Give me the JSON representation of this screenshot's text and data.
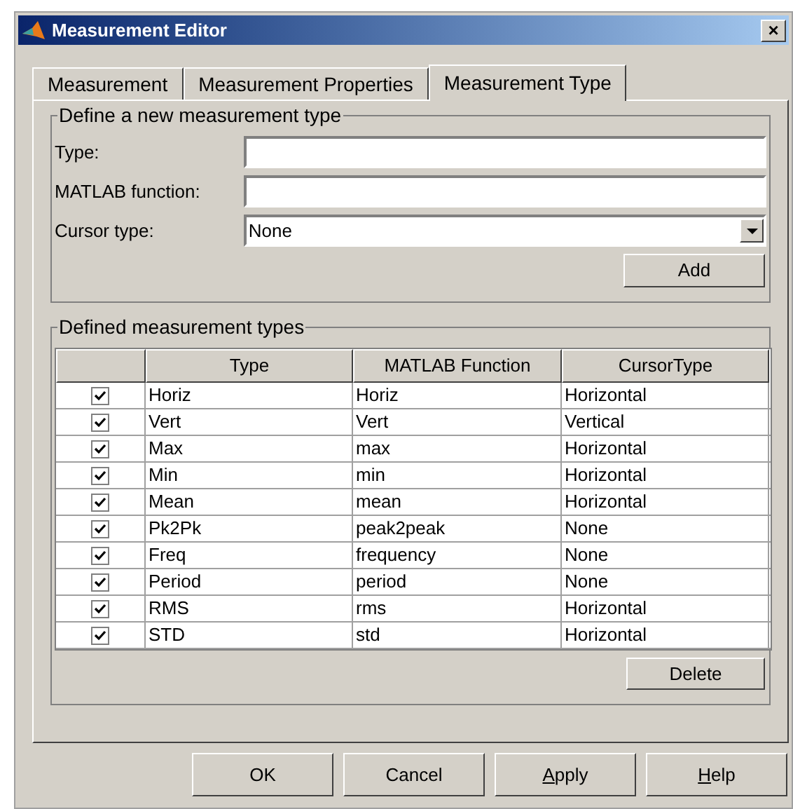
{
  "window": {
    "title": "Measurement Editor",
    "close": "×"
  },
  "tabs": [
    {
      "label": "Measurement",
      "selected": false
    },
    {
      "label": "Measurement Properties",
      "selected": false
    },
    {
      "label": "Measurement Type",
      "selected": true
    }
  ],
  "define_group": {
    "title": "Define a new measurement type",
    "type_label": "Type:",
    "function_label": "MATLAB function:",
    "cursor_label": "Cursor type:",
    "cursor_value": "None",
    "add_button": "Add"
  },
  "types_group": {
    "title": "Defined measurement types",
    "columns": [
      "",
      "Type",
      "MATLAB Function",
      "CursorType"
    ],
    "rows": [
      {
        "checked": true,
        "type": "Horiz",
        "function": "Horiz",
        "cursor": "Horizontal"
      },
      {
        "checked": true,
        "type": "Vert",
        "function": "Vert",
        "cursor": "Vertical"
      },
      {
        "checked": true,
        "type": "Max",
        "function": "max",
        "cursor": "Horizontal"
      },
      {
        "checked": true,
        "type": "Min",
        "function": "min",
        "cursor": "Horizontal"
      },
      {
        "checked": true,
        "type": "Mean",
        "function": "mean",
        "cursor": "Horizontal"
      },
      {
        "checked": true,
        "type": "Pk2Pk",
        "function": "peak2peak",
        "cursor": "None"
      },
      {
        "checked": true,
        "type": "Freq",
        "function": "frequency",
        "cursor": "None"
      },
      {
        "checked": true,
        "type": "Period",
        "function": "period",
        "cursor": "None"
      },
      {
        "checked": true,
        "type": "RMS",
        "function": "rms",
        "cursor": "Horizontal"
      },
      {
        "checked": true,
        "type": "STD",
        "function": "std",
        "cursor": "Horizontal"
      }
    ],
    "delete_button": "Delete"
  },
  "buttons": [
    {
      "label": "OK",
      "underline_first": false
    },
    {
      "label": "Cancel",
      "underline_first": false
    },
    {
      "label": "Apply",
      "underline_first": true
    },
    {
      "label": "Help",
      "underline_first": true
    }
  ]
}
